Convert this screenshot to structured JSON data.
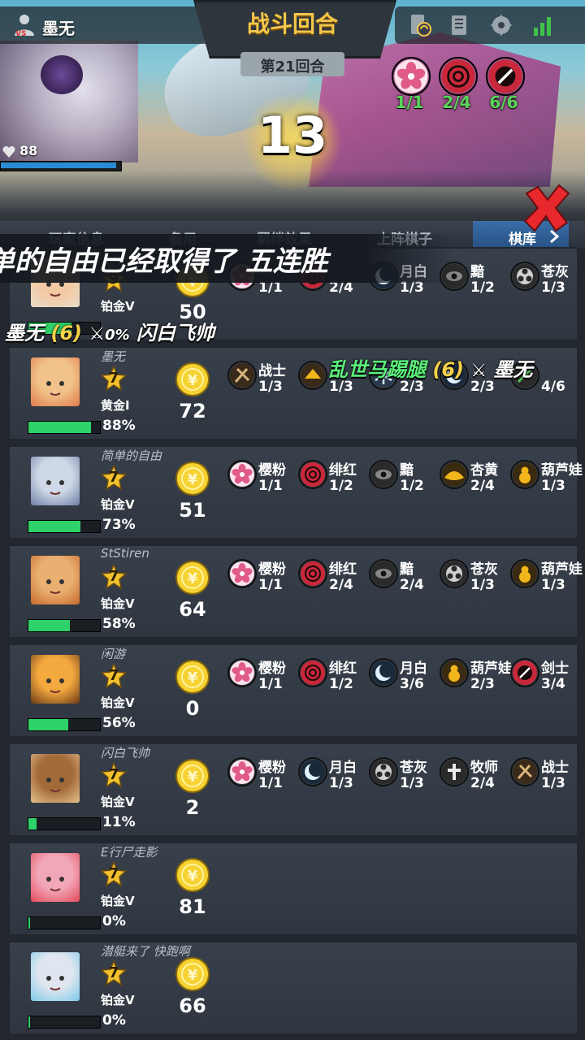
{
  "header": {
    "player_name": "墨无",
    "title": "战斗回合",
    "round": "第21回合",
    "timer": "13",
    "hp": "88"
  },
  "active_synergies": [
    {
      "icon": "sakura-icon",
      "value": "1/1",
      "color": "#e05a8a"
    },
    {
      "icon": "crimson-rose-icon",
      "value": "2/4",
      "color": "#c8283a"
    },
    {
      "icon": "sword-ring-icon",
      "value": "6/6",
      "color": "#c8283a"
    }
  ],
  "tabs": [
    {
      "label": "玩家信息"
    },
    {
      "label": "备用"
    },
    {
      "label": "羁绊效果"
    },
    {
      "label": "上阵棋子"
    },
    {
      "label": "棋库"
    }
  ],
  "banner": "单的自由已经取得了 五连胜",
  "feed": [
    {
      "left": "墨无",
      "count": "(6)",
      "right": "闪白飞帅",
      "extra": "0%"
    },
    {
      "left": "乱世马踢腿",
      "count": "(6)",
      "right": "墨无"
    }
  ],
  "players": [
    {
      "name": "",
      "level": "9",
      "rank": "铂金V",
      "gold": "50",
      "hp_pct": "",
      "hp_fill": 0.6,
      "synergies": [
        {
          "icon": "sakura-icon",
          "name": "",
          "value": "1/1",
          "color": "#e88aa8"
        },
        {
          "icon": "crimson-rose-icon",
          "name": "",
          "value": "2/4",
          "color": "#c8283a"
        },
        {
          "icon": "crescent-moon-icon",
          "name": "月白",
          "value": "1/3",
          "color": "#dff2ff"
        },
        {
          "icon": "dark-eye-icon",
          "name": "黯",
          "value": "1/2",
          "color": "#2a2a2a"
        },
        {
          "icon": "triskelion-icon",
          "name": "苍灰",
          "value": "1/3",
          "color": "#2a2a2a"
        }
      ]
    },
    {
      "name": "墨无",
      "level": "7",
      "rank": "黄金I",
      "gold": "72",
      "hp_pct": "88%",
      "hp_fill": 0.88,
      "synergies": [
        {
          "icon": "warrior-icon",
          "name": "战士",
          "value": "1/3",
          "color": "#3a2a1a"
        },
        {
          "icon": "gold-crest-icon",
          "name": "",
          "value": "1/3",
          "color": "#3a2a1a"
        },
        {
          "icon": "snowflake-icon",
          "name": "",
          "value": "2/3",
          "color": "#2a3a4a"
        },
        {
          "icon": "crescent-moon-icon",
          "name": "",
          "value": "2/3",
          "color": "#dff2ff"
        },
        {
          "icon": "green-sword-icon",
          "name": "",
          "value": "4/6",
          "color": "#2a2a2a"
        }
      ]
    },
    {
      "name": "简单的自由",
      "level": "7",
      "rank": "铂金V",
      "gold": "51",
      "hp_pct": "73%",
      "hp_fill": 0.73,
      "synergies": [
        {
          "icon": "sakura-icon",
          "name": "樱粉",
          "value": "1/1",
          "color": "#e88aa8"
        },
        {
          "icon": "crimson-rose-icon",
          "name": "绯红",
          "value": "1/2",
          "color": "#c8283a"
        },
        {
          "icon": "dark-eye-icon",
          "name": "黯",
          "value": "1/2",
          "color": "#2a2a2a"
        },
        {
          "icon": "lotus-icon",
          "name": "杏黄",
          "value": "2/4",
          "color": "#f2b61c"
        },
        {
          "icon": "gourd-icon",
          "name": "葫芦娃",
          "value": "1/3",
          "color": "#f2b61c"
        }
      ]
    },
    {
      "name": "StStiren",
      "level": "7",
      "rank": "铂金V",
      "gold": "64",
      "hp_pct": "58%",
      "hp_fill": 0.58,
      "synergies": [
        {
          "icon": "sakura-icon",
          "name": "樱粉",
          "value": "1/1",
          "color": "#e88aa8"
        },
        {
          "icon": "crimson-rose-icon",
          "name": "绯红",
          "value": "2/4",
          "color": "#c8283a"
        },
        {
          "icon": "dark-eye-icon",
          "name": "黯",
          "value": "2/4",
          "color": "#2a2a2a"
        },
        {
          "icon": "triskelion-icon",
          "name": "苍灰",
          "value": "1/3",
          "color": "#2a2a2a"
        },
        {
          "icon": "gourd-icon",
          "name": "葫芦娃",
          "value": "1/3",
          "color": "#f2b61c"
        }
      ]
    },
    {
      "name": "闲游",
      "level": "7",
      "rank": "铂金V",
      "gold": "0",
      "hp_pct": "56%",
      "hp_fill": 0.56,
      "synergies": [
        {
          "icon": "sakura-icon",
          "name": "樱粉",
          "value": "1/1",
          "color": "#e88aa8"
        },
        {
          "icon": "crimson-rose-icon",
          "name": "绯红",
          "value": "1/2",
          "color": "#c8283a"
        },
        {
          "icon": "crescent-moon-icon",
          "name": "月白",
          "value": "3/6",
          "color": "#dff2ff"
        },
        {
          "icon": "gourd-icon",
          "name": "葫芦娃",
          "value": "2/3",
          "color": "#f2b61c"
        },
        {
          "icon": "sword-ring-icon",
          "name": "剑士",
          "value": "3/4",
          "color": "#c8283a"
        }
      ]
    },
    {
      "name": "闪白飞帅",
      "level": "7",
      "rank": "铂金V",
      "gold": "2",
      "hp_pct": "11%",
      "hp_fill": 0.11,
      "synergies": [
        {
          "icon": "sakura-icon",
          "name": "樱粉",
          "value": "1/1",
          "color": "#e88aa8"
        },
        {
          "icon": "crescent-moon-icon",
          "name": "月白",
          "value": "1/3",
          "color": "#dff2ff"
        },
        {
          "icon": "triskelion-icon",
          "name": "苍灰",
          "value": "1/3",
          "color": "#2a2a2a"
        },
        {
          "icon": "priest-cross-icon",
          "name": "牧师",
          "value": "2/4",
          "color": "#e8e8e8"
        },
        {
          "icon": "warrior-icon",
          "name": "战士",
          "value": "1/3",
          "color": "#3a2a1a"
        }
      ]
    },
    {
      "name": "E行尸走影",
      "level": "7",
      "rank": "铂金V",
      "gold": "81",
      "hp_pct": "0%",
      "hp_fill": 0.02,
      "synergies": []
    },
    {
      "name": "潜艇来了 快跑啊",
      "level": "7",
      "rank": "铂金V",
      "gold": "66",
      "hp_pct": "0%",
      "hp_fill": 0.02,
      "synergies": []
    }
  ]
}
